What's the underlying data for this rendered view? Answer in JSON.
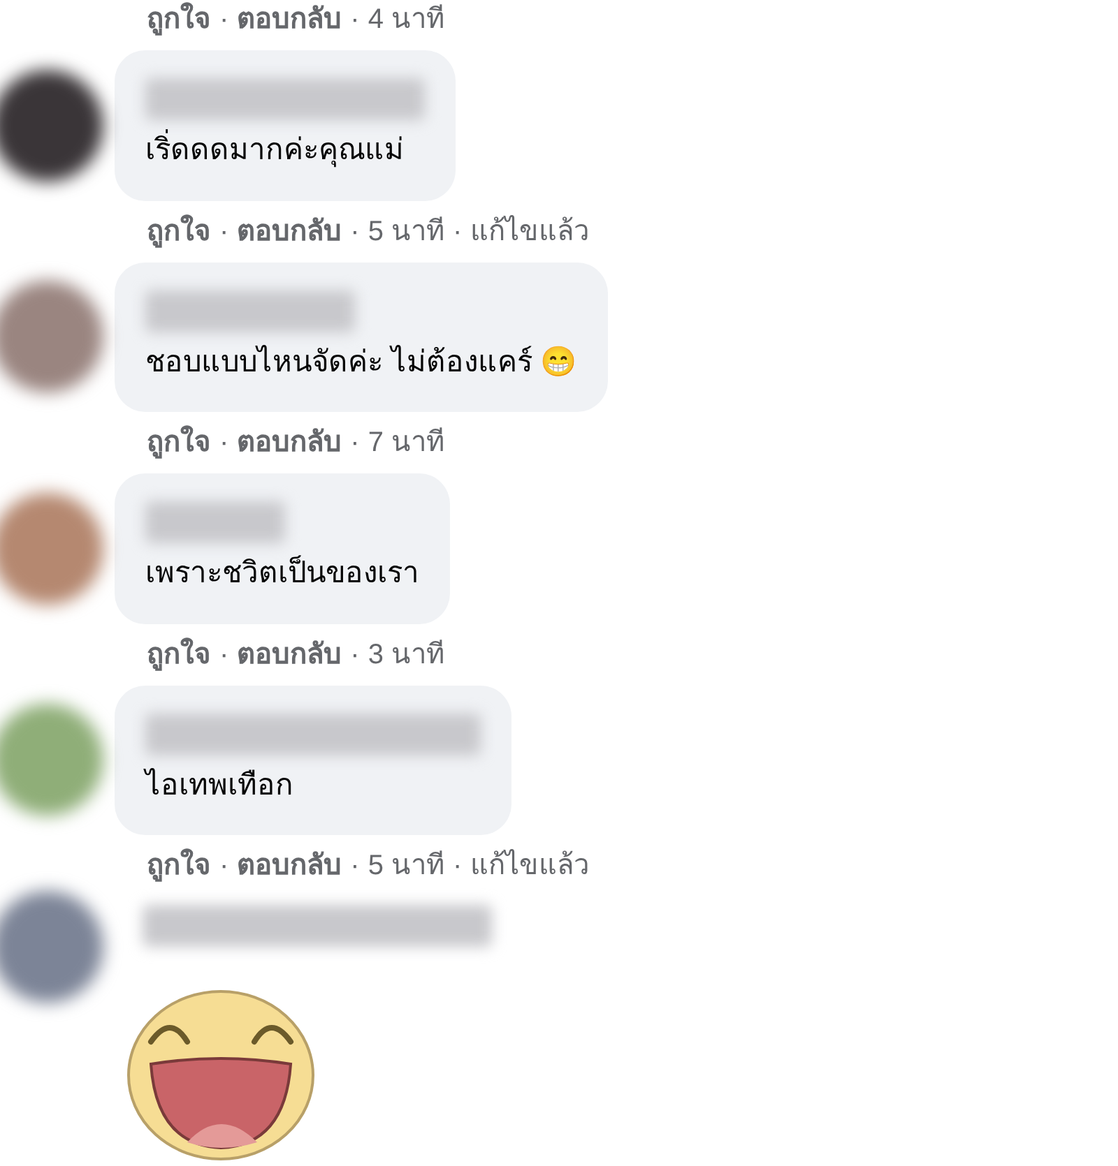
{
  "top_actions": {
    "separator": "·",
    "like": "ถูกใจ",
    "reply": "ตอบกลับ",
    "time": "4 นาที"
  },
  "comments": [
    {
      "kind": "text",
      "text": "เริ่ดดดมากค่ะคุณแม่",
      "actions": {
        "separator": "·",
        "like": "ถูกใจ",
        "reply": "ตอบกลับ",
        "time": "5 นาที",
        "edited": "แก้ไขแล้ว"
      }
    },
    {
      "kind": "text",
      "text": "ชอบแบบไหนจัดค่ะ ไม่ต้องแคร์ 😁",
      "actions": {
        "separator": "·",
        "like": "ถูกใจ",
        "reply": "ตอบกลับ",
        "time": "7 นาที"
      }
    },
    {
      "kind": "text",
      "text": "เพราะชวิตเป็นของเรา",
      "actions": {
        "separator": "·",
        "like": "ถูกใจ",
        "reply": "ตอบกลับ",
        "time": "3 นาที"
      }
    },
    {
      "kind": "text",
      "text": "ไอเทพเทือก",
      "actions": {
        "separator": "·",
        "like": "ถูกใจ",
        "reply": "ตอบกลับ",
        "time": "5 นาที",
        "edited": "แก้ไขแล้ว"
      }
    },
    {
      "kind": "sticker"
    }
  ]
}
